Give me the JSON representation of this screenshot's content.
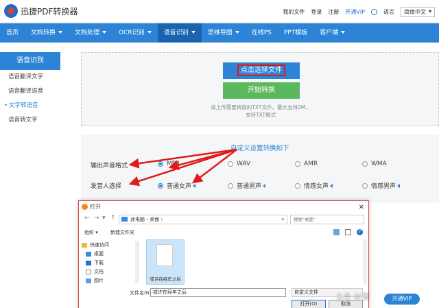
{
  "header": {
    "brand": "迅捷PDF转换器",
    "links": [
      "我的文件",
      "登录",
      "注册",
      "开通VIP"
    ],
    "lang_label": "语言",
    "lang_value": "简体中文"
  },
  "nav": {
    "items": [
      {
        "label": "首页",
        "caret": false
      },
      {
        "label": "文档转换",
        "caret": true
      },
      {
        "label": "文档处理",
        "caret": true
      },
      {
        "label": "OCR识别",
        "caret": true
      },
      {
        "label": "语音识别",
        "caret": true,
        "active": true
      },
      {
        "label": "思维导图",
        "caret": true
      },
      {
        "label": "在线PS",
        "caret": false
      },
      {
        "label": "PPT模板",
        "caret": false
      },
      {
        "label": "客户端",
        "caret": true
      }
    ]
  },
  "sidebar": {
    "title": "语音识别",
    "items": [
      "语音翻译文字",
      "语音翻译语音",
      "文字转语音",
      "语音转文字"
    ],
    "active_index": 2
  },
  "upload": {
    "select_button": "点击选择文件",
    "convert_button": "开始转换",
    "hint_line1": "请上传需要转换的TXT文件，最大支持2M，",
    "hint_line2": "支持TXT格式"
  },
  "options": {
    "title": "自定义设置转换如下",
    "format_label": "输出声音格式",
    "formats": [
      "MP3",
      "WAV",
      "AMR",
      "WMA"
    ],
    "format_selected": "MP3",
    "voice_label": "发音人选择",
    "voices": [
      "普通女声",
      "普通男声",
      "情感女声",
      "情感男声"
    ],
    "voice_selected": "普通女声"
  },
  "dialog": {
    "title": "打开",
    "path": [
      "此电脑",
      "桌面"
    ],
    "search_placeholder": "搜索\"桌面\"",
    "organize": "组织 ▾",
    "new_folder": "新建文件夹",
    "tree": [
      "快速访问",
      "桌面",
      "下载",
      "文档",
      "图片"
    ],
    "file_name_display": "或许在经年之后",
    "filename_label": "文件名(N):",
    "filename_value": "或许在经年之后",
    "filetype": "自定义文件",
    "open_button": "打开(O)",
    "cancel_button": "取消"
  },
  "float": {
    "vip": "开通VIP",
    "watermark": "头条 @懂"
  },
  "colors": {
    "primary": "#2d83d6",
    "nav_active": "#1a63b0",
    "convert": "#5cb85c",
    "highlight": "#e01a1a"
  }
}
